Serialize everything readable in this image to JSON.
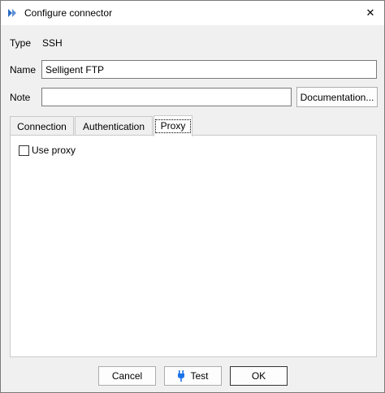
{
  "window": {
    "title": "Configure connector",
    "close_glyph": "✕"
  },
  "form": {
    "type_label": "Type",
    "type_value": "SSH",
    "name_label": "Name",
    "name_value": "Selligent FTP",
    "note_label": "Note",
    "note_value": "",
    "documentation_button": "Documentation..."
  },
  "tabs": [
    {
      "label": "Connection",
      "active": false
    },
    {
      "label": "Authentication",
      "active": false
    },
    {
      "label": "Proxy",
      "active": true
    }
  ],
  "proxy_panel": {
    "use_proxy_label": "Use proxy",
    "use_proxy_checked": false
  },
  "footer": {
    "cancel_label": "Cancel",
    "test_label": "Test",
    "ok_label": "OK"
  },
  "colors": {
    "app_icon": "#2b6cc4",
    "plug_icon": "#1a73e8"
  },
  "icons": {
    "app": "connector-app-icon",
    "close": "close-icon",
    "test": "plug-icon"
  }
}
